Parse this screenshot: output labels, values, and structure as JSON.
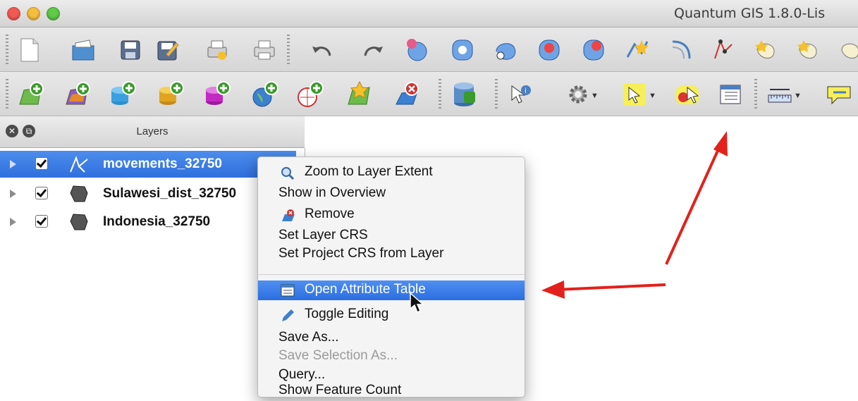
{
  "window": {
    "title": "Quantum GIS 1.8.0-Lis"
  },
  "toolbar1": {
    "icons": [
      "new-project-icon",
      "open-project-icon",
      "save-project-icon",
      "save-as-icon",
      "print-composer-icon",
      "print-icon",
      "undo-icon",
      "redo-icon",
      "add-feature-icon",
      "move-feature-icon",
      "node-tool-icon",
      "delete-selected-icon",
      "cut-features-icon",
      "capture-point-icon",
      "simplify-icon",
      "add-ring-icon",
      "add-part-icon",
      "fill-ring-icon",
      "delete-ring-icon"
    ]
  },
  "toolbar2": {
    "icons": [
      "add-vector-layer-icon",
      "add-raster-layer-icon",
      "add-postgis-layer-icon",
      "add-spatialite-layer-icon",
      "add-mssql-layer-icon",
      "add-wms-layer-icon",
      "add-wfs-layer-icon",
      "new-shapefile-icon",
      "remove-layer-icon",
      "open-db-manager-icon",
      "identify-features-icon",
      "gear-dropdown-icon",
      "select-features-icon",
      "deselect-features-icon",
      "attribute-table-icon",
      "measure-icon",
      "annotation-icon"
    ]
  },
  "layers_panel": {
    "title": "Layers",
    "layers": [
      {
        "name": "movements_32750",
        "checked": true,
        "selected": true,
        "icon": "line-layer-icon"
      },
      {
        "name": "Sulawesi_dist_32750",
        "checked": true,
        "selected": false,
        "icon": "polygon-layer-icon"
      },
      {
        "name": "Indonesia_32750",
        "checked": true,
        "selected": false,
        "icon": "polygon-layer-icon"
      }
    ]
  },
  "context_menu": {
    "items": [
      {
        "label": "Zoom to Layer Extent",
        "icon": "zoom-icon"
      },
      {
        "label": "Show in Overview"
      },
      {
        "label": "Remove",
        "icon": "remove-icon"
      },
      {
        "label": "Set Layer CRS"
      },
      {
        "label": "Set Project CRS from Layer"
      },
      {
        "label": "Open Attribute Table",
        "icon": "table-icon",
        "highlighted": true
      },
      {
        "label": "Toggle Editing",
        "icon": "pencil-icon"
      },
      {
        "label": "Save As..."
      },
      {
        "label": "Save Selection As...",
        "disabled": true
      },
      {
        "label": "Query..."
      },
      {
        "label": "Show Feature Count"
      }
    ]
  },
  "colors": {
    "selection_blue": "#3a7be6",
    "annotation_red": "#e3211c"
  }
}
